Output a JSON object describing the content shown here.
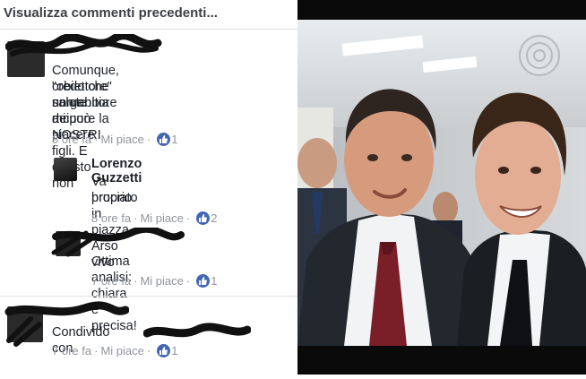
{
  "thread": {
    "view_previous": "Visualizza commenti precedenti..."
  },
  "comments": [
    {
      "text_lines": [
        "Comunque, credo che un genitore",
        "\"obiettore\" non abbia a cuore la",
        "salute dei NOSTRI figli. E questo non",
        "mi può piacere"
      ],
      "time": "8 ore fa",
      "like_label": "Mi piace",
      "likes": "1"
    },
    {
      "author": "Lorenzo Guzzetti",
      "text_lines": [
        "Va bruciato in piazza. Arso vivo",
        "proprio."
      ],
      "time": "8 ore fa",
      "like_label": "Mi piace",
      "likes": "2"
    },
    {
      "text_lines": [
        "Ottima analisi: chiara e precisa!"
      ],
      "time": "7 ore fa",
      "like_label": "Mi piace",
      "likes": "1"
    },
    {
      "text_lines": [
        "Condivido con"
      ],
      "time": "7 ore fa",
      "like_label": "Mi piace",
      "likes": "1"
    }
  ],
  "colors": {
    "like_blue": "#4267b2",
    "meta_grey": "#90949c",
    "text_dark": "#1d2129"
  }
}
